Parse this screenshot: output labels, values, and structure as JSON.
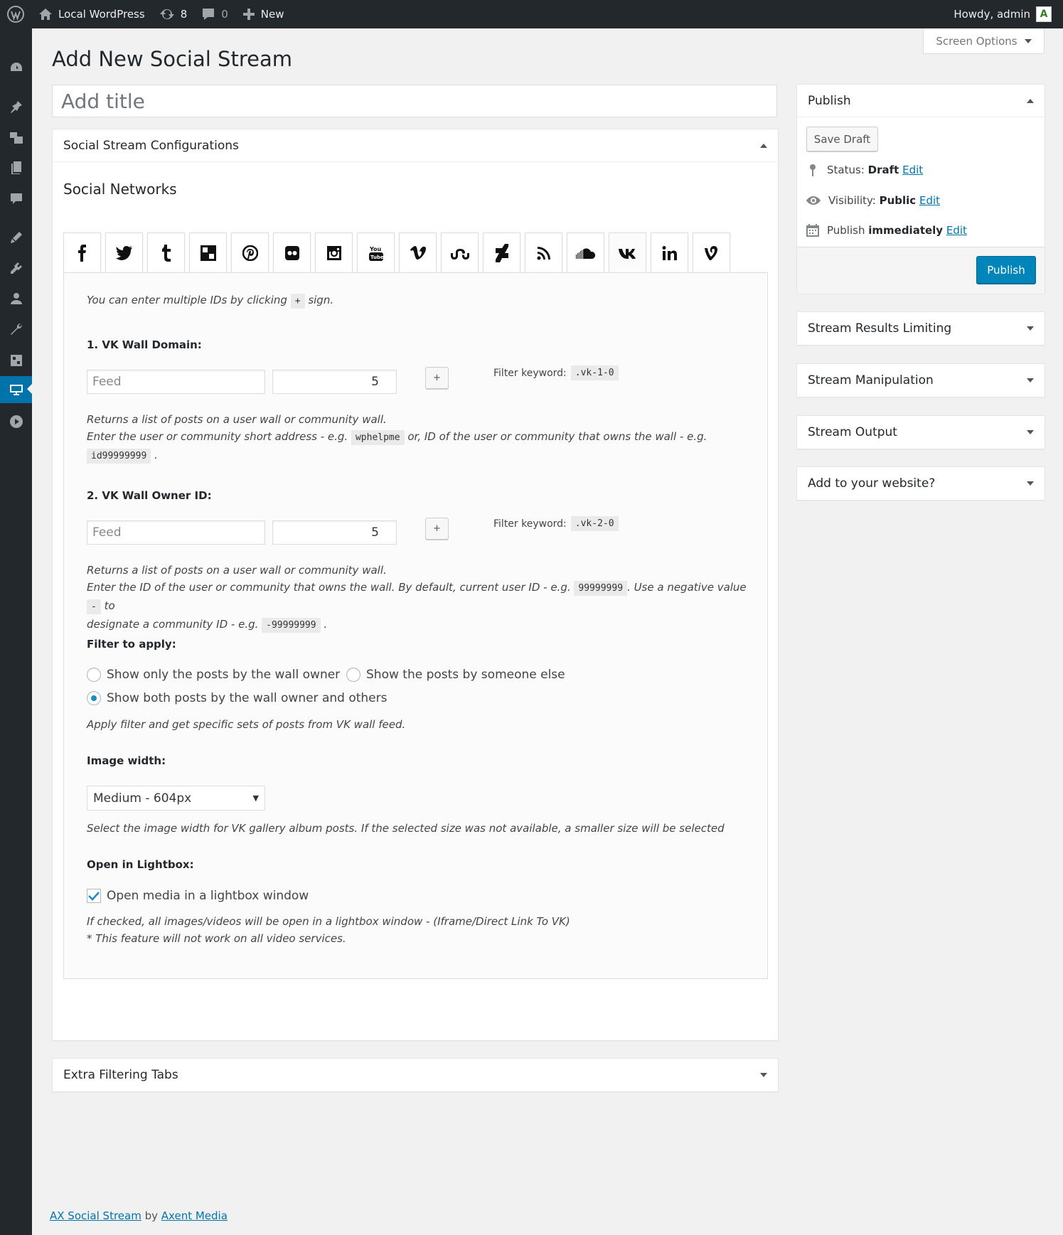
{
  "admin_bar": {
    "site_name": "Local WordPress",
    "updates_count": "8",
    "comments_count": "0",
    "new_label": "New",
    "greeting": "Howdy, admin"
  },
  "admin_menu": {
    "icons": [
      "dashboard-icon",
      "posts-icon",
      "media-icon",
      "pages-icon",
      "comments-icon",
      "appearance-icon",
      "plugins-icon",
      "users-icon",
      "tools-icon",
      "settings-icon",
      "social-stream-icon",
      "video-icon"
    ],
    "current": "social-stream-icon"
  },
  "screen_options": {
    "label": "Screen Options"
  },
  "page": {
    "title": "Add New Social Stream",
    "title_placeholder": "Add title"
  },
  "config": {
    "box_title": "Social Stream Configurations",
    "networks_heading": "Social Networks",
    "networks": [
      "facebook",
      "twitter",
      "tumblr",
      "delicious",
      "pinterest",
      "flickr",
      "instagram",
      "youtube",
      "vimeo",
      "stumbleupon",
      "deviantart",
      "rss",
      "soundcloud",
      "vk",
      "linkedin",
      "vine"
    ],
    "active_network": "vk",
    "intro_before": "You can enter multiple IDs by clicking",
    "intro_code": "+",
    "intro_after": "sign.",
    "field1": {
      "label": "1. VK Wall Domain",
      "feed_placeholder": "Feed",
      "count": "5",
      "plus": "+",
      "filter_label": "Filter keyword:",
      "filter_code": ".vk-1-0",
      "desc_line1": "Returns a list of posts on a user wall or community wall.",
      "desc_line2_a": "Enter the user or community short address - e.g.",
      "desc_code1": "wphelpme",
      "desc_line2_b": "or, ID of the user or community that owns the wall - e.g.",
      "desc_code2": "id99999999",
      "desc_end": "."
    },
    "field2": {
      "label": "2. VK Wall Owner ID",
      "feed_placeholder": "Feed",
      "count": "5",
      "plus": "+",
      "filter_label": "Filter keyword:",
      "filter_code": ".vk-2-0",
      "desc_line1": "Returns a list of posts on a user wall or community wall.",
      "desc_line2_a": "Enter the ID of the user or community that owns the wall. By default, current user ID - e.g.",
      "desc_code1": "99999999",
      "desc_line2_b": ". Use a negative value",
      "desc_code2": "-",
      "desc_line2_c": "to",
      "desc_line3_a": "designate a community ID - e.g.",
      "desc_code3": "-99999999",
      "desc_end": "."
    },
    "filter": {
      "label": "Filter to apply",
      "option1": "Show only the posts by the wall owner",
      "option2": "Show the posts by someone else",
      "option3": "Show both posts by the wall owner and others",
      "selected": "option3",
      "desc": "Apply filter and get specific sets of posts from VK wall feed."
    },
    "image_width": {
      "label": "Image width",
      "selected": "Medium - 604px",
      "desc": "Select the image width for VK gallery album posts. If the selected size was not available, a smaller size will be selected"
    },
    "lightbox": {
      "label": "Open in Lightbox",
      "checkbox_label": "Open media in a lightbox window",
      "checked": true,
      "desc_line1": "If checked, all images/videos will be open in a lightbox window - (Iframe/Direct Link To VK)",
      "desc_line2": "* This feature will not work on all video services."
    },
    "colon": ":"
  },
  "extra_tabs": {
    "title": "Extra Filtering Tabs"
  },
  "publish": {
    "title": "Publish",
    "save_draft": "Save Draft",
    "status_label": "Status:",
    "status_value": "Draft",
    "visibility_label": "Visibility:",
    "visibility_value": "Public",
    "publish_label": "Publish",
    "publish_value": "immediately",
    "edit": "Edit",
    "publish_button": "Publish"
  },
  "sidebar_boxes": [
    "Stream Results Limiting",
    "Stream Manipulation",
    "Stream Output",
    "Add to your website?"
  ],
  "footer": {
    "plugin": "AX Social Stream",
    "by": "by",
    "author": "Axent Media"
  }
}
